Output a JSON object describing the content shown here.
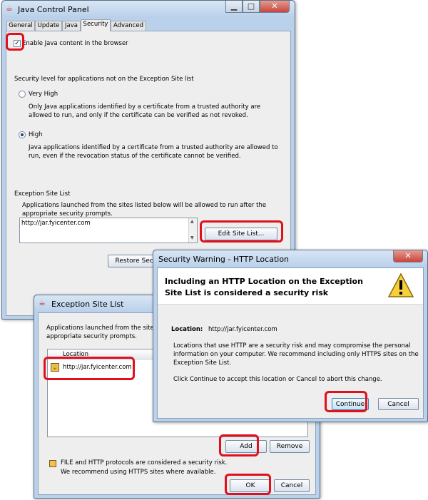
{
  "java_control_panel": {
    "title": "Java Control Panel",
    "tabs": [
      "General",
      "Update",
      "Java",
      "Security",
      "Advanced"
    ],
    "enable_checkbox_label": "Enable Java content in the browser",
    "enable_checked": true,
    "security_level_heading": "Security level for applications not on the Exception Site list",
    "very_high_label": "Very High",
    "very_high_desc": [
      "Only Java applications identified by a certificate from a trusted authority are",
      "allowed to run, and only if the certificate can be verified as not revoked."
    ],
    "high_label": "High",
    "high_desc": [
      "Java applications identified by a certificate from a trusted authority are allowed to",
      "run, even if the revocation status of the certificate cannot be verified."
    ],
    "exception_heading": "Exception Site List",
    "exception_desc": [
      "Applications launched from the sites listed below will be allowed to run after the",
      "appropriate security prompts."
    ],
    "site_entry": "http://jar.fyicenter.com",
    "edit_site_list_button": "Edit Site List...",
    "restore_button": "Restore Secu"
  },
  "exception_site_list_dialog": {
    "title": "Exception Site List",
    "desc": [
      "Applications launched from the sites",
      "appropriate security prompts."
    ],
    "column_header": "Location",
    "entry": "http://jar.fyicenter.com",
    "add_button": "Add",
    "remove_button": "Remove",
    "note": [
      "FILE and HTTP protocols are considered a security risk.",
      "We recommend using HTTPS sites where available."
    ],
    "ok_button": "OK",
    "cancel_button": "Cancel"
  },
  "security_warning_dialog": {
    "title": "Security Warning - HTTP Location",
    "heading": [
      "Including an HTTP Location on the Exception",
      "Site List is considered a security risk"
    ],
    "location_label": "Location:",
    "location_value": "http://jar.fyicenter.com",
    "body": [
      "Locations that use HTTP are a security risk and may compromise the personal",
      "information on your computer.  We recommend including only HTTPS sites on the",
      "Exception Site List."
    ],
    "instruction": "Click Continue to accept this location or Cancel to abort this change.",
    "continue_button": "Continue",
    "cancel_button": "Cancel"
  },
  "icons": {
    "java": "java-icon",
    "warning": "warning-icon",
    "lock": "lock-icon",
    "minimize": "minimize-icon",
    "maximize": "maximize-icon",
    "close": "close-icon"
  },
  "colors": {
    "highlight": "#e0101c",
    "close_button": "#c9463d",
    "window_frame": "#b9d1ea",
    "dialog_bg": "#eeeeee"
  }
}
